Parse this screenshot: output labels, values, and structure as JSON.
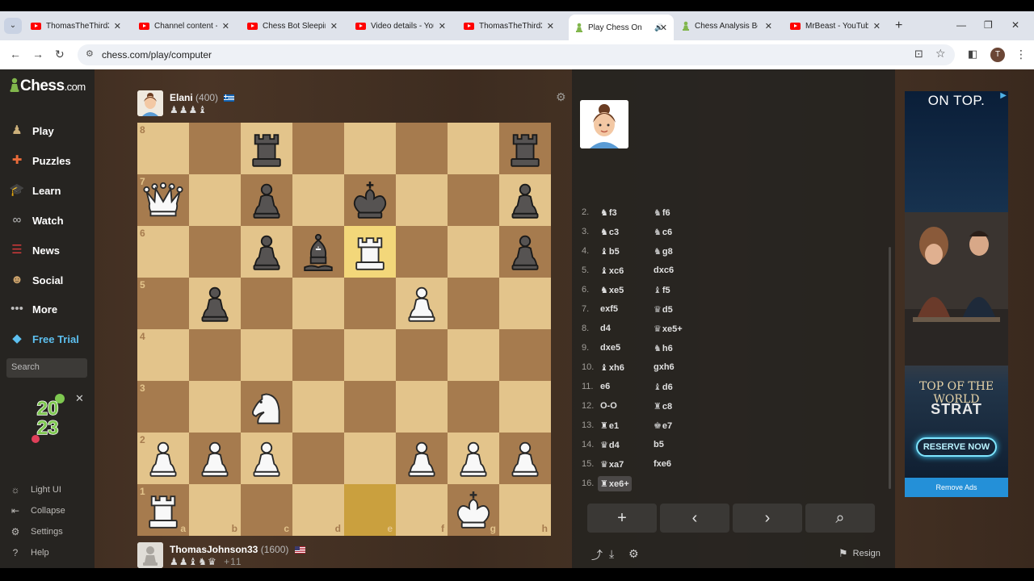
{
  "browser": {
    "tabs": [
      {
        "title": "ThomasTheThird3",
        "type": "youtube"
      },
      {
        "title": "Channel content -",
        "type": "youtube"
      },
      {
        "title": "Chess Bot Sleepin",
        "type": "youtube"
      },
      {
        "title": "Video details - You",
        "type": "youtube"
      },
      {
        "title": "ThomasTheThird3",
        "type": "youtube"
      },
      {
        "title": "Play Chess On",
        "type": "chess",
        "active": true
      },
      {
        "title": "Chess Analysis Bo",
        "type": "chess"
      },
      {
        "title": "MrBeast - YouTub",
        "type": "youtube"
      }
    ],
    "url": "chess.com/play/computer",
    "profile_initial": "T"
  },
  "sidebar": {
    "logo": "Chess",
    "logo_suffix": ".com",
    "items": [
      {
        "label": "Play",
        "icon": "play-pawn-icon",
        "color": "#ccb07a"
      },
      {
        "label": "Puzzles",
        "icon": "puzzle-icon",
        "color": "#e96b3a"
      },
      {
        "label": "Learn",
        "icon": "learn-icon",
        "color": "#3aa0c8"
      },
      {
        "label": "Watch",
        "icon": "binoculars-icon",
        "color": "#bcbcbc"
      },
      {
        "label": "News",
        "icon": "news-icon",
        "color": "#d23a3a"
      },
      {
        "label": "Social",
        "icon": "social-icon",
        "color": "#c9a06a"
      },
      {
        "label": "More",
        "icon": "more-dots-icon",
        "color": "#bcbcbc"
      },
      {
        "label": "Free Trial",
        "icon": "diamond-icon",
        "color": "#5dc0f0"
      }
    ],
    "search_placeholder": "Search",
    "badge_year_top": "20",
    "badge_year_bottom": "23",
    "bottom": [
      {
        "label": "Light UI",
        "icon": "sun-icon"
      },
      {
        "label": "Collapse",
        "icon": "collapse-icon"
      },
      {
        "label": "Settings",
        "icon": "settings-icon"
      },
      {
        "label": "Help",
        "icon": "help-icon"
      }
    ]
  },
  "opponent": {
    "name": "Elani",
    "rating": "(400)",
    "flag": "greece",
    "captured": "♟♟♟♝"
  },
  "player": {
    "name": "ThomasJohnson33",
    "rating": "(1600)",
    "flag": "usa",
    "captured": "♟♟♝♞♛",
    "advantage": "+11"
  },
  "board": {
    "files": [
      "a",
      "b",
      "c",
      "d",
      "e",
      "f",
      "g",
      "h"
    ],
    "ranks": [
      "8",
      "7",
      "6",
      "5",
      "4",
      "3",
      "2",
      "1"
    ],
    "highlight": [
      "e6",
      "e1"
    ],
    "position": {
      "c8": "bR",
      "h8": "bR",
      "a7": "wQ",
      "c7": "bP",
      "e7": "bK",
      "h7": "bP",
      "c6": "bP",
      "d6": "bB",
      "e6": "wR",
      "h6": "bP",
      "b5": "bP",
      "f5": "wP",
      "c3": "wN",
      "a2": "wP",
      "b2": "wP",
      "c2": "wP",
      "f2": "wP",
      "g2": "wP",
      "h2": "wP",
      "a1": "wR",
      "g1": "wK"
    }
  },
  "moves": [
    {
      "n": "2.",
      "w": "f3",
      "wp": "N",
      "b": "f6",
      "bp": "N"
    },
    {
      "n": "3.",
      "w": "c3",
      "wp": "N",
      "b": "c6",
      "bp": "N"
    },
    {
      "n": "4.",
      "w": "b5",
      "wp": "B",
      "b": "g8",
      "bp": "N"
    },
    {
      "n": "5.",
      "w": "xc6",
      "wp": "B",
      "b": "dxc6",
      "bp": ""
    },
    {
      "n": "6.",
      "w": "xe5",
      "wp": "N",
      "b": "f5",
      "bp": "B"
    },
    {
      "n": "7.",
      "w": "exf5",
      "wp": "",
      "b": "d5",
      "bp": "Q"
    },
    {
      "n": "8.",
      "w": "d4",
      "wp": "",
      "b": "xe5+",
      "bp": "Q"
    },
    {
      "n": "9.",
      "w": "dxe5",
      "wp": "",
      "b": "h6",
      "bp": "N"
    },
    {
      "n": "10.",
      "w": "xh6",
      "wp": "B",
      "b": "gxh6",
      "bp": ""
    },
    {
      "n": "11.",
      "w": "e6",
      "wp": "",
      "b": "d6",
      "bp": "B"
    },
    {
      "n": "12.",
      "w": "O-O",
      "wp": "",
      "b": "c8",
      "bp": "R"
    },
    {
      "n": "13.",
      "w": "e1",
      "wp": "R",
      "b": "e7",
      "bp": "K"
    },
    {
      "n": "14.",
      "w": "d4",
      "wp": "Q",
      "b": "b5",
      "bp": ""
    },
    {
      "n": "15.",
      "w": "xa7",
      "wp": "Q",
      "b": "fxe6",
      "bp": ""
    },
    {
      "n": "16.",
      "w": "xe6+",
      "wp": "R",
      "b": "",
      "bp": "",
      "current": true
    }
  ],
  "controls": [
    "+",
    "‹",
    "›",
    "⌕"
  ],
  "resign_label": "Resign",
  "ad": {
    "headline": "ON TOP.",
    "logo_line1": "TOP OF THE WORLD",
    "logo_line2": "STRAT",
    "button": "RESERVE NOW",
    "remove_ads": "Remove Ads"
  }
}
